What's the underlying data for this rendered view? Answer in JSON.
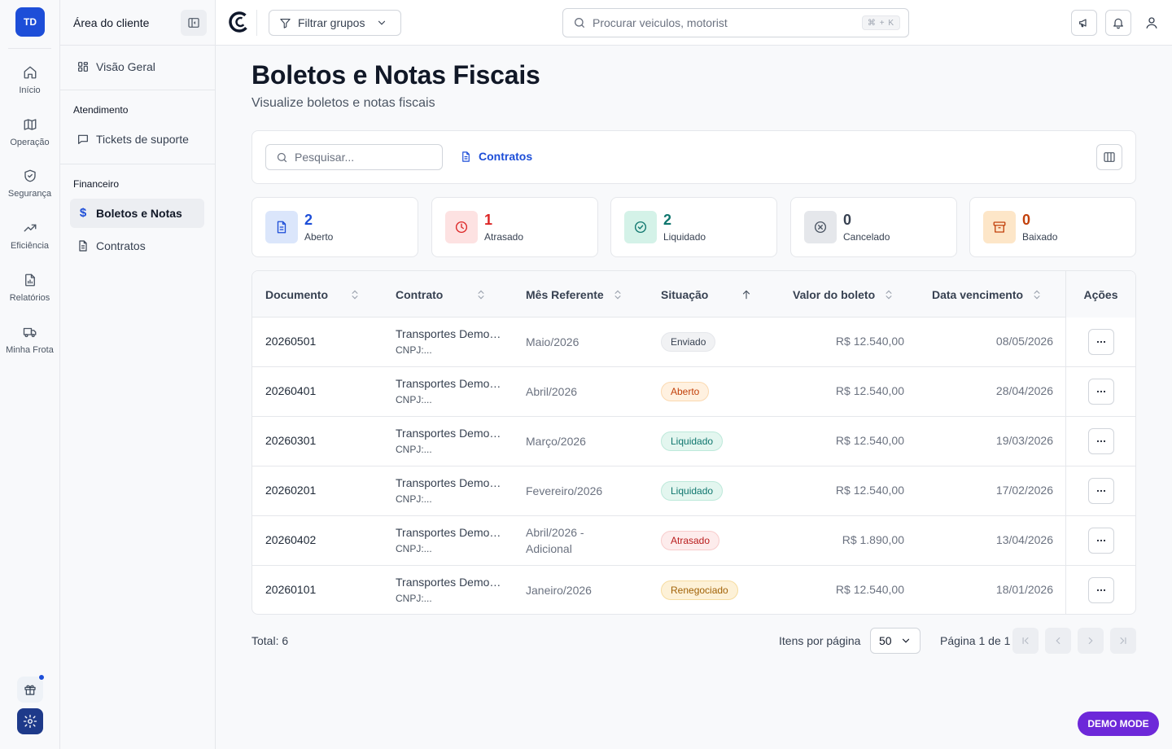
{
  "rail": {
    "brand": "TD",
    "items": [
      {
        "label": "Início",
        "icon": "home-icon"
      },
      {
        "label": "Operação",
        "icon": "map-icon"
      },
      {
        "label": "Segurança",
        "icon": "shield-icon"
      },
      {
        "label": "Eficiência",
        "icon": "trending-up-icon"
      },
      {
        "label": "Relatórios",
        "icon": "file-chart-icon"
      },
      {
        "label": "Minha Frota",
        "icon": "truck-icon"
      }
    ]
  },
  "sidebar": {
    "title": "Área do cliente",
    "overview": "Visão Geral",
    "group_atendimento": "Atendimento",
    "tickets": "Tickets de suporte",
    "group_financeiro": "Financeiro",
    "boletos": "Boletos e Notas",
    "contratos": "Contratos"
  },
  "topbar": {
    "filter_label": "Filtrar grupos",
    "search_placeholder": "Procurar veiculos, motorist",
    "shortcut": "⌘ + K"
  },
  "page": {
    "title": "Boletos e Notas Fiscais",
    "subtitle": "Visualize boletos e notas fiscais"
  },
  "toolbar": {
    "search_placeholder": "Pesquisar...",
    "contracts_link": "Contratos"
  },
  "stats": [
    {
      "value": "2",
      "label": "Aberto",
      "color": "#1d4ed8",
      "bg": "#dbe6fb",
      "icon": "document-icon"
    },
    {
      "value": "1",
      "label": "Atrasado",
      "color": "#dc2626",
      "bg": "#fde2e2",
      "icon": "clock-icon"
    },
    {
      "value": "2",
      "label": "Liquidado",
      "color": "#0f766e",
      "bg": "#d4f2e8",
      "icon": "check-circle-icon"
    },
    {
      "value": "0",
      "label": "Cancelado",
      "color": "#4b5563",
      "bg": "#e5e7eb",
      "icon": "x-circle-icon"
    },
    {
      "value": "0",
      "label": "Baixado",
      "color": "#c2410c",
      "bg": "#fde6c8",
      "icon": "archive-icon"
    }
  ],
  "table": {
    "columns": {
      "documento": "Documento",
      "contrato": "Contrato",
      "mes": "Mês Referente",
      "situacao": "Situação",
      "valor": "Valor do boleto",
      "vencimento": "Data vencimento",
      "acoes": "Ações"
    },
    "rows": [
      {
        "documento": "20260501",
        "contrato": "Transportes Demo Ltda",
        "cnpj": "CNPJ:...",
        "mes": "Maio/2026",
        "situacao": "Enviado",
        "valor": "R$ 12.540,00",
        "vencimento": "08/05/2026"
      },
      {
        "documento": "20260401",
        "contrato": "Transportes Demo Ltda",
        "cnpj": "CNPJ:...",
        "mes": "Abril/2026",
        "situacao": "Aberto",
        "valor": "R$ 12.540,00",
        "vencimento": "28/04/2026"
      },
      {
        "documento": "20260301",
        "contrato": "Transportes Demo Ltda",
        "cnpj": "CNPJ:...",
        "mes": "Março/2026",
        "situacao": "Liquidado",
        "valor": "R$ 12.540,00",
        "vencimento": "19/03/2026"
      },
      {
        "documento": "20260201",
        "contrato": "Transportes Demo Ltda",
        "cnpj": "CNPJ:...",
        "mes": "Fevereiro/2026",
        "situacao": "Liquidado",
        "valor": "R$ 12.540,00",
        "vencimento": "17/02/2026"
      },
      {
        "documento": "20260402",
        "contrato": "Transportes Demo Ltda",
        "cnpj": "CNPJ:...",
        "mes": "Abril/2026 - Adicional",
        "situacao": "Atrasado",
        "valor": "R$ 1.890,00",
        "vencimento": "13/04/2026"
      },
      {
        "documento": "20260101",
        "contrato": "Transportes Demo Ltda",
        "cnpj": "CNPJ:...",
        "mes": "Janeiro/2026",
        "situacao": "Renegociado",
        "valor": "R$ 12.540,00",
        "vencimento": "18/01/2026"
      }
    ]
  },
  "badge_styles": {
    "Enviado": {
      "bg": "#f1f2f4",
      "fg": "#374151",
      "border": "#e5e7eb"
    },
    "Aberto": {
      "bg": "#fff1e0",
      "fg": "#c2410c",
      "border": "#fbd9b0"
    },
    "Liquidado": {
      "bg": "#e3f6ef",
      "fg": "#0f766e",
      "border": "#bde9da"
    },
    "Atrasado": {
      "bg": "#fdecec",
      "fg": "#b91c1c",
      "border": "#f8cccc"
    },
    "Renegociado": {
      "bg": "#fdf1d7",
      "fg": "#a16207",
      "border": "#f6dca0"
    }
  },
  "footer": {
    "total": "Total: 6",
    "items_per_page_label": "Itens por página",
    "items_per_page": "50",
    "page_label": "Página 1 de 1"
  },
  "demo_mode": "DEMO MODE"
}
